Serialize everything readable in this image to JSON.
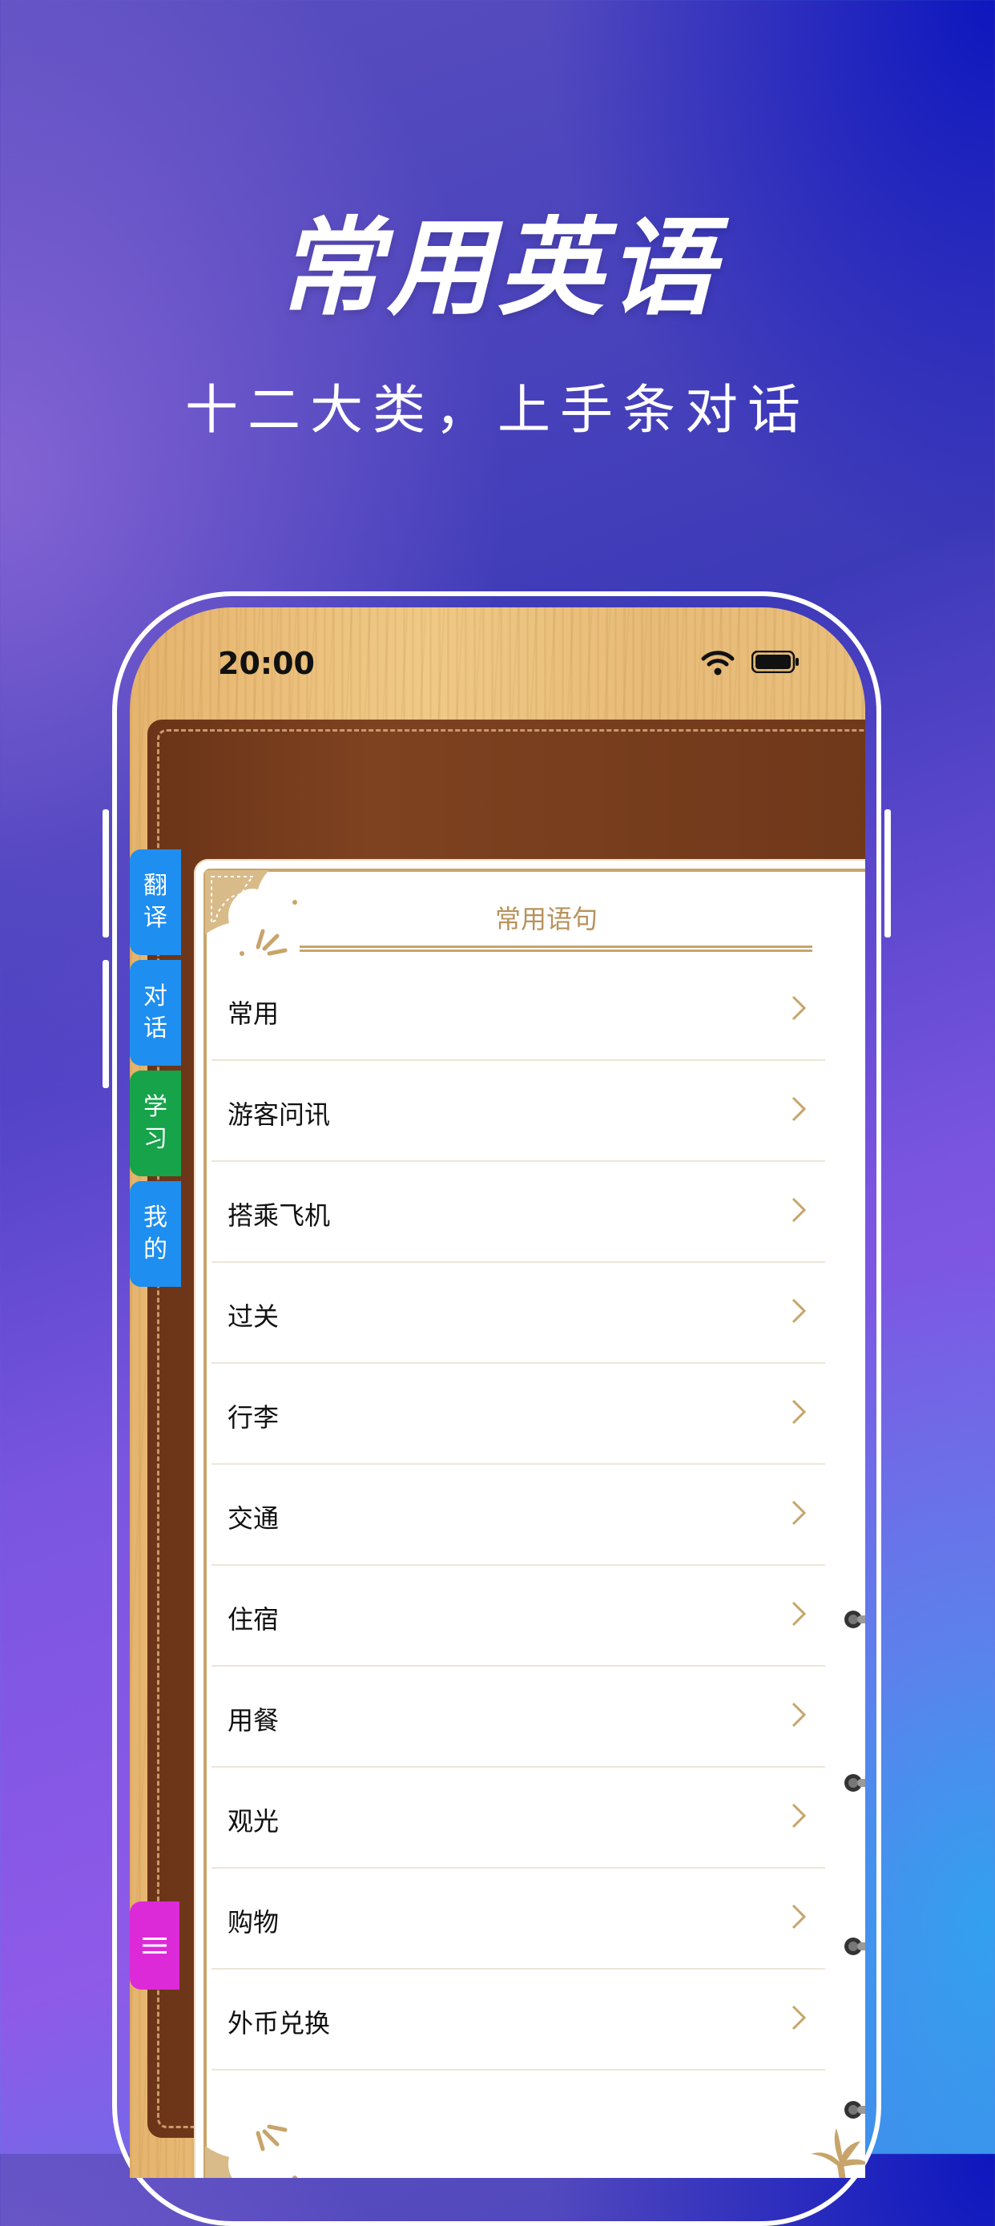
{
  "hero": {
    "title": "常用英语",
    "subtitle": "十二大类，上手条对话"
  },
  "status_bar": {
    "time": "20:00",
    "icons": [
      "wifi-icon",
      "battery-icon"
    ]
  },
  "page": {
    "title": "常用语句"
  },
  "categories": [
    {
      "label": "常用"
    },
    {
      "label": "游客问讯"
    },
    {
      "label": "搭乘飞机"
    },
    {
      "label": "过关"
    },
    {
      "label": "行李"
    },
    {
      "label": "交通"
    },
    {
      "label": "住宿"
    },
    {
      "label": "用餐"
    },
    {
      "label": "观光"
    },
    {
      "label": "购物"
    },
    {
      "label": "外币兑换"
    }
  ],
  "side_tabs": [
    {
      "line1": "翻",
      "line2": "译",
      "color": "#1e8ef0"
    },
    {
      "line1": "对",
      "line2": "话",
      "color": "#1e8ef0"
    },
    {
      "line1": "学",
      "line2": "习",
      "color": "#16a34a"
    },
    {
      "line1": "我",
      "line2": "的",
      "color": "#1e8ef0"
    }
  ],
  "menu_button": {
    "icon": "menu-icon",
    "color": "#dd2ad8"
  },
  "colors": {
    "accent_gold": "#c8a46a",
    "leather": "#7e4220",
    "wood": "#f0c987"
  }
}
